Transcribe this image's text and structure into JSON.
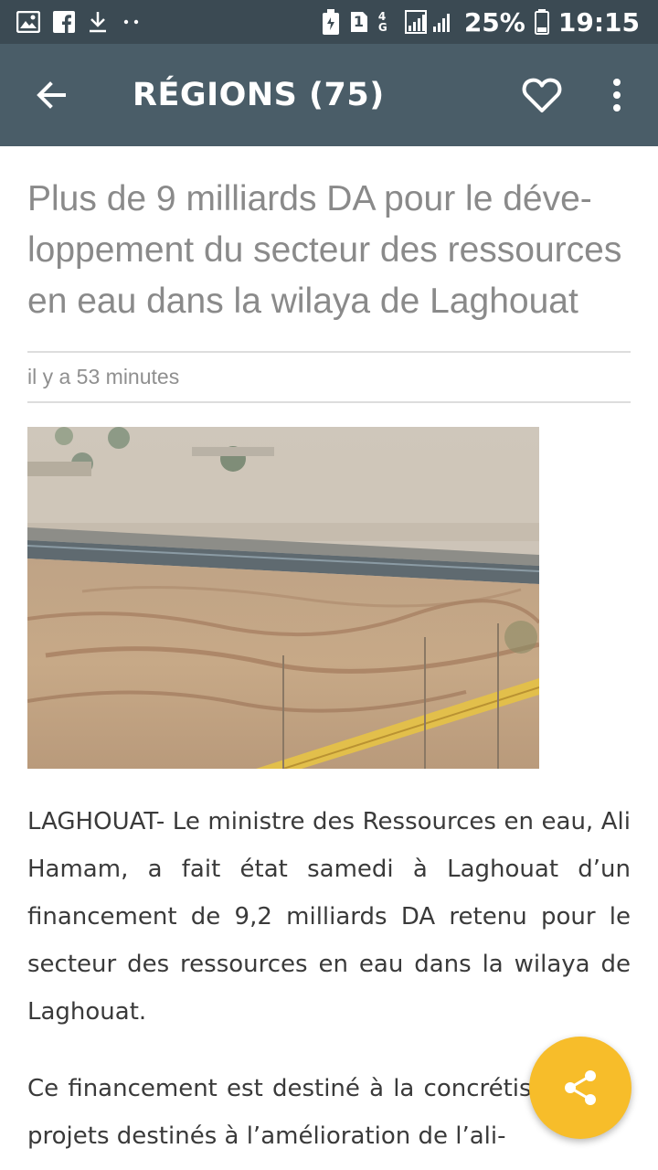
{
  "status_bar": {
    "battery_percent": "25%",
    "time": "19:15",
    "network_type": "4G",
    "sim_slot": "1",
    "icons": [
      "image-icon",
      "facebook-icon",
      "download-icon",
      "more-notifications-icon",
      "battery-saver-icon",
      "sim-icon",
      "signal-icon",
      "battery-icon"
    ]
  },
  "toolbar": {
    "title": "RÉGIONS (75)",
    "icons": [
      "back-arrow-icon",
      "heart-icon",
      "more-vert-icon"
    ]
  },
  "article": {
    "title": "Plus de 9 milliards DA pour le déve-loppement du secteur des ressources en eau dans la wilaya de Laghouat",
    "timestamp": "il y a 53 minutes",
    "paragraphs": [
      "LAGHOUAT- Le ministre des Ressources en eau, Ali Hamam, a fait état samedi à Laghouat d’un financement de 9,2 milliards DA retenu pour le secteur des ressources en eau dans la wilaya de Laghouat.",
      "Ce financement est destiné à la concrétisation de projets destinés à l’amélioration de l’ali-"
    ]
  },
  "fab": {
    "icon": "share-icon"
  },
  "colors": {
    "status_bar": "#3b4a53",
    "toolbar": "#4a5d68",
    "fab": "#f7bd2a",
    "title_text": "#8a8a8a",
    "body_text": "#3a3a3a"
  }
}
